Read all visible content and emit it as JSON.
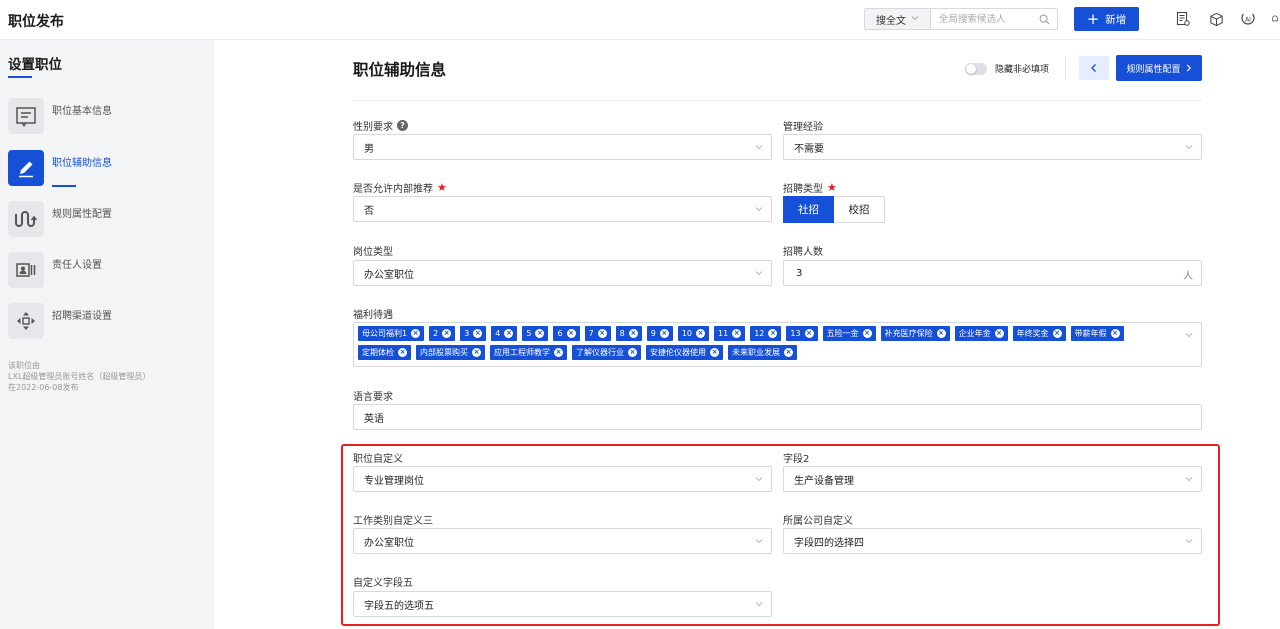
{
  "app": {
    "title": "职位发布"
  },
  "topbar": {
    "search_scope": "搜全文",
    "search_placeholder": "全局搜索候选人",
    "add_label": "新增"
  },
  "sidebar": {
    "title": "设置职位",
    "items": [
      {
        "label": "职位基本信息",
        "icon": "form-icon",
        "active": false
      },
      {
        "label": "职位辅助信息",
        "icon": "edit-icon",
        "active": true
      },
      {
        "label": "规则属性配置",
        "icon": "rules-icon",
        "active": false
      },
      {
        "label": "责任人设置",
        "icon": "person-card-icon",
        "active": false
      },
      {
        "label": "招聘渠道设置",
        "icon": "move-icon",
        "active": false
      }
    ],
    "info": [
      "该职位由",
      "LXL超级管理员账号姓名（超级管理员）",
      "在2022-06-08发布"
    ]
  },
  "header": {
    "title": "职位辅助信息",
    "toggle_label": "隐藏非必填项",
    "rules_button": "规则属性配置"
  },
  "fields": {
    "gender": {
      "label": "性别要求",
      "value": "男"
    },
    "management": {
      "label": "管理经验",
      "value": "不需要"
    },
    "internal": {
      "label": "是否允许内部推荐",
      "value": "否"
    },
    "recruit_type": {
      "label": "招聘类型",
      "options": [
        "社招",
        "校招"
      ],
      "selected": "社招"
    },
    "post_type": {
      "label": "岗位类型",
      "value": "办公室职位"
    },
    "headcount": {
      "label": "招聘人数",
      "value": "3",
      "unit": "人"
    },
    "welfare": {
      "label": "福利待遇",
      "tags": [
        "母公司福利1",
        "2",
        "3",
        "4",
        "5",
        "6",
        "7",
        "8",
        "9",
        "10",
        "11",
        "12",
        "13",
        "五险一金",
        "补充医疗保险",
        "企业年金",
        "年终奖金",
        "带薪年假",
        "定期体检",
        "内部股票购买",
        "应用工程师教学",
        "了解仪器行业",
        "安捷伦仪器使用",
        "未来职业发展"
      ]
    },
    "language": {
      "label": "语言要求",
      "value": "英语"
    },
    "custom1": {
      "label": "职位自定义",
      "value": "专业管理岗位"
    },
    "custom2": {
      "label": "字段2",
      "value": "生产设备管理"
    },
    "custom3": {
      "label": "工作类别自定义三",
      "value": "办公室职位"
    },
    "custom4": {
      "label": "所属公司自定义",
      "value": "字段四的选择四"
    },
    "custom5": {
      "label": "自定义字段五",
      "value": "字段五的选项五"
    }
  },
  "colors": {
    "accent": "#1550d6",
    "highlight": "#e8201e"
  }
}
